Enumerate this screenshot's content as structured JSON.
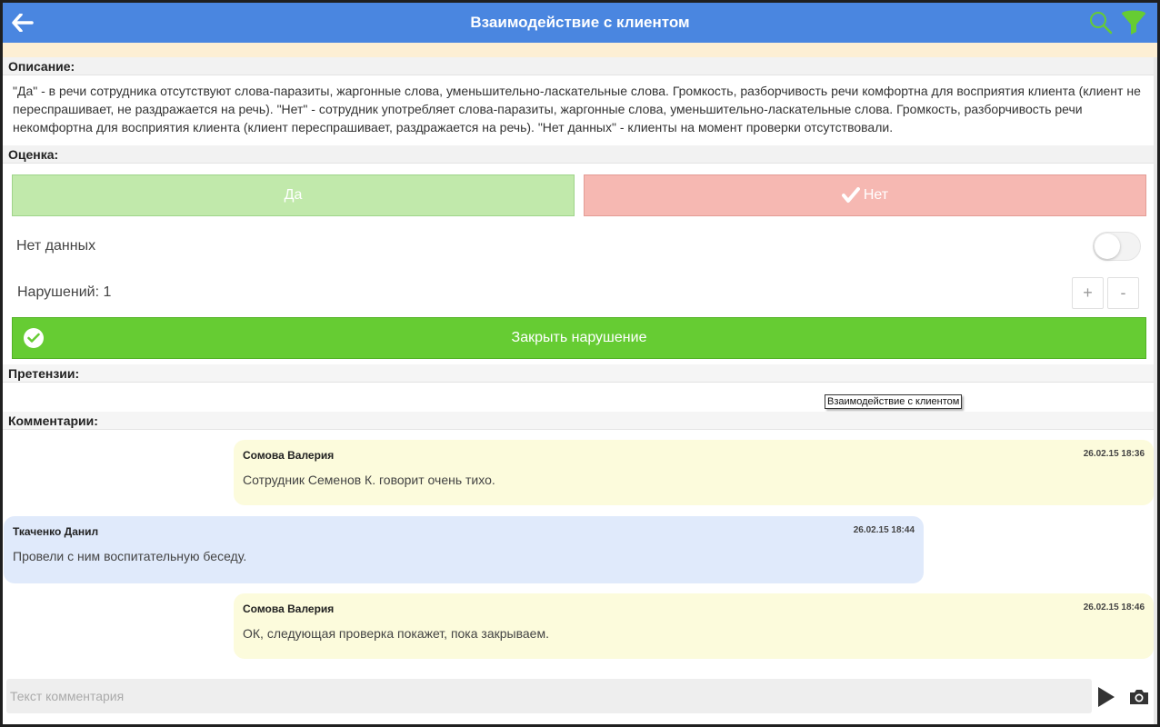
{
  "header": {
    "title": "Взаимодействие с клиентом",
    "bg_color": "#4a86e0",
    "icons": {
      "back": "arrow-left-icon",
      "search": "search-icon",
      "filter": "filter-icon"
    },
    "icon_color": "#66cc33"
  },
  "description": {
    "label": "Описание:",
    "text": "\"Да\" - в речи сотрудника отсутствуют слова-паразиты, жаргонные слова, уменьшительно-ласкательные слова. Громкость, разборчивость речи комфортна для восприятия клиента (клиент не переспрашивает, не раздражается на речь). \"Нет\" - сотрудник употребляет слова-паразиты, жаргонные слова, уменьшительно-ласкательные слова. Громкость, разборчивость речи некомфортна для восприятия клиента (клиент переспрашивает, раздражается на речь). \"Нет данных\" - клиенты на момент проверки отсутствовали."
  },
  "rating": {
    "label": "Оценка:",
    "yes_label": "Да",
    "no_label": "Нет",
    "selected": "Нет",
    "yes_color": "#c1e9ab",
    "no_color": "#f6b8b2"
  },
  "no_data": {
    "label": "Нет данных",
    "enabled": false
  },
  "violations": {
    "label": "Нарушений: 1",
    "plus_label": "+",
    "minus_label": "-"
  },
  "close_button": {
    "label": "Закрыть нарушение",
    "color": "#66cc33"
  },
  "claims": {
    "label": "Претензии:"
  },
  "tooltip": {
    "text": "Взаимодействие с клиентом"
  },
  "comments": {
    "label": "Комментарии:",
    "items": [
      {
        "author": "Сомова Валерия",
        "time": "26.02.15 18:36",
        "text": "Сотрудник Семенов К. говорит очень тихо.",
        "side": "right",
        "color": "#fcfbdc"
      },
      {
        "author": "Ткаченко Данил",
        "time": "26.02.15 18:44",
        "text": "Провели с ним воспитательную беседу.",
        "side": "left",
        "color": "#e0eafb"
      },
      {
        "author": "Сомова Валерия",
        "time": "26.02.15 18:46",
        "text": "ОК, следующая проверка покажет, пока закрываем.",
        "side": "right",
        "color": "#fcfbdc"
      }
    ]
  },
  "input": {
    "placeholder": "Текст комментария",
    "value": "",
    "send_icon": "send-icon",
    "camera_icon": "camera-icon"
  }
}
